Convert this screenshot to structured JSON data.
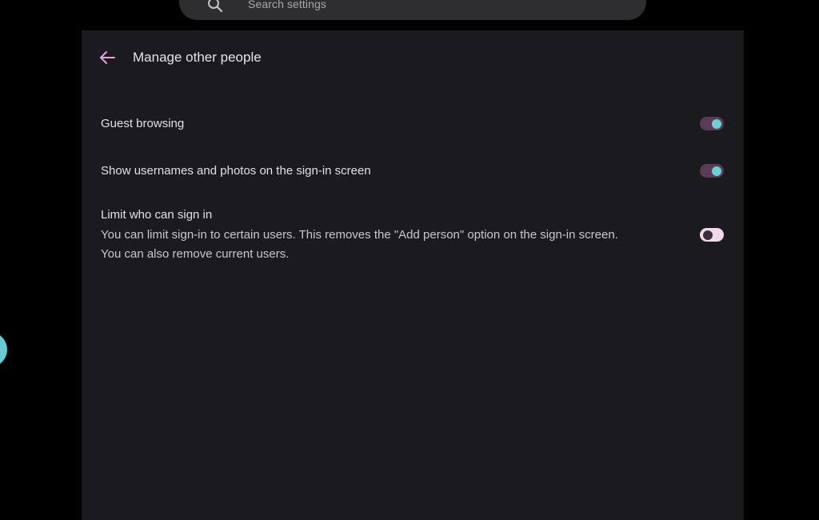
{
  "search": {
    "placeholder": "Search settings",
    "icon": "search-icon"
  },
  "header": {
    "back_icon": "arrow-left-icon",
    "title": "Manage other people"
  },
  "settings": [
    {
      "label": "Guest browsing",
      "enabled": true
    },
    {
      "label": "Show usernames and photos on the sign-in screen",
      "enabled": true
    },
    {
      "label": "Limit who can sign in",
      "description_line1": "You can limit sign-in to certain users. This removes the \"Add person\" option on the sign-in screen.",
      "description_line2": "You can also remove current users.",
      "enabled": false
    }
  ],
  "colors": {
    "background": "#000000",
    "panel": "#1b1b1f",
    "search_bar": "#2e2e30",
    "accent_back_arrow": "#e6a6dc",
    "toggle_on_track": "#5a3c57",
    "toggle_on_knob": "#6cd0d6",
    "toggle_off_track": "#f0d8ee",
    "toggle_off_knob": "#3a2f3a"
  }
}
